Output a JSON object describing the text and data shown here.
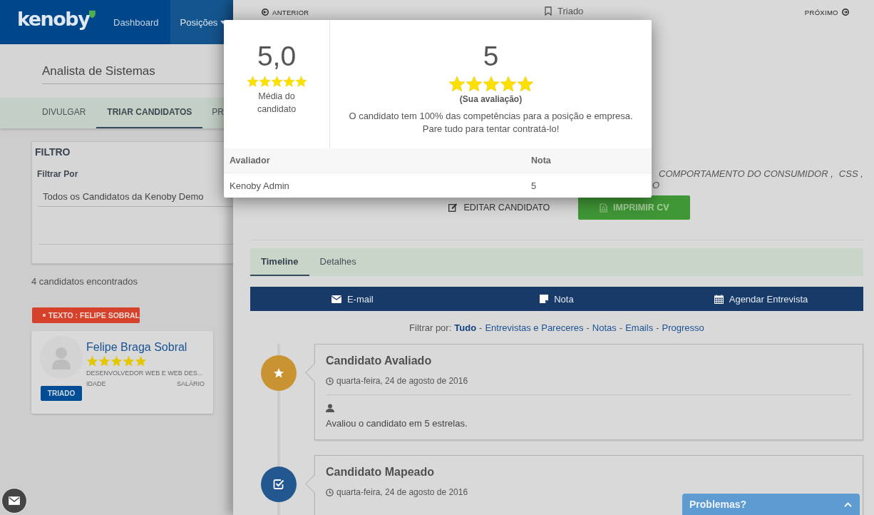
{
  "header": {
    "logo": "kenoby",
    "nav": [
      {
        "label": "Dashboard",
        "selected": false
      },
      {
        "label": "Posições",
        "selected": true
      }
    ]
  },
  "position": {
    "title": "Analista de Sistemas",
    "tabs": [
      {
        "label": "DIVULGAR",
        "selected": false
      },
      {
        "label": "TRIAR CANDIDATOS",
        "selected": true
      },
      {
        "label": "PR",
        "selected": false
      }
    ]
  },
  "filter": {
    "title": "FILTRO",
    "label": "Filtrar Por",
    "value": "Todos os Candidatos da Kenoby Demo"
  },
  "results_count": "4 candidatos encontrados",
  "active_filters": [
    {
      "label": "TEXTO : FELIPE SOBRAL"
    }
  ],
  "candidates": [
    {
      "name": "Felipe Braga Sobral",
      "stars": 5,
      "role": "DESENVOLVEDOR WEB E WEB DES...",
      "age_label": "IDADE",
      "salary_label": "SALÁRIO",
      "status": "TRIADO"
    }
  ],
  "detail": {
    "prev": "ANTERIOR",
    "status": "Triado",
    "next": "PRÓXIMO",
    "skills": [
      "COMPORTAMENTO DO CONSUMIDOR ,",
      "CSS ,"
    ],
    "skills_continued": "O",
    "actions": [
      {
        "label": "EDITAR CANDIDATO",
        "kind": "edit"
      },
      {
        "label": "IMPRIMIR CV",
        "kind": "print"
      }
    ],
    "tabs": [
      {
        "label": "Timeline",
        "selected": true
      },
      {
        "label": "Detalhes",
        "selected": false
      }
    ],
    "toolbar": [
      {
        "label": "E-mail",
        "kind": "email"
      },
      {
        "label": "Nota",
        "kind": "note"
      },
      {
        "label": "Agendar Entrevista",
        "kind": "schedule"
      }
    ],
    "timeline_filter": {
      "label": "Filtrar por:",
      "separator": "-",
      "options": [
        {
          "label": "Tudo",
          "selected": true
        },
        {
          "label": "Entrevistas e Pareceres",
          "selected": false
        },
        {
          "label": "Notas",
          "selected": false
        },
        {
          "label": "Emails",
          "selected": false
        },
        {
          "label": "Progresso",
          "selected": false
        }
      ]
    },
    "timeline": [
      {
        "kind": "rating",
        "color": "#c99332",
        "title": "Candidato Avaliado",
        "date": "quarta-feira, 24 de agosto de 2016",
        "text": "Avaliou o candidato em 5 estrelas."
      },
      {
        "kind": "mapped",
        "color": "#22578f",
        "title": "Candidato Mapeado",
        "date": "quarta-feira, 24 de agosto de 2016"
      }
    ]
  },
  "rating_popup": {
    "average": "5,0",
    "average_rating": {
      "stars": 5
    },
    "average_label": "Média do candidato",
    "own": "5",
    "own_rating": {
      "stars": 5
    },
    "own_label": "(Sua avaliação)",
    "message": "O candidato tem 100% das competências para a posição e empresa.\nPare tudo para tentar contratá-lo!",
    "columns": [
      "Avaliador",
      "Nota"
    ],
    "rows": [
      [
        "Kenoby Admin",
        "5"
      ]
    ]
  },
  "help_widget": {
    "label": "Problemas?"
  }
}
